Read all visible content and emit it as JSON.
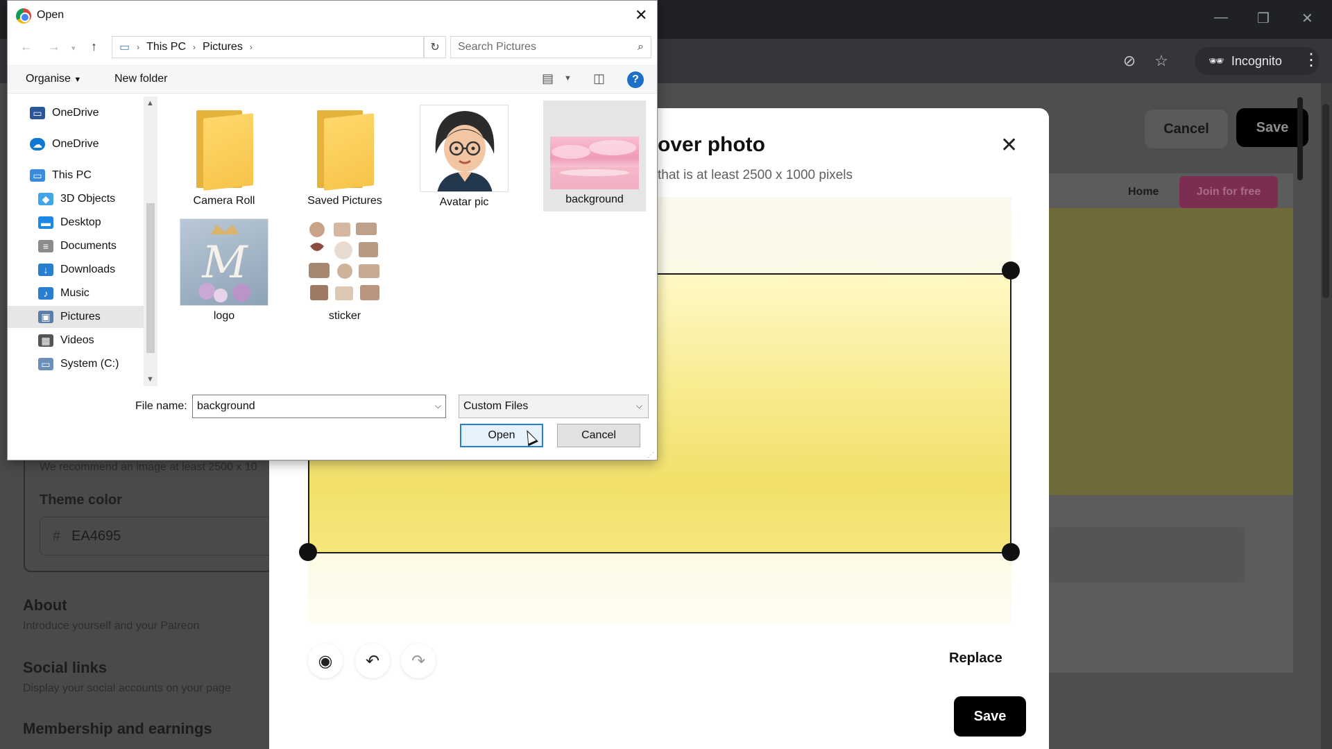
{
  "dialog": {
    "title": "Open",
    "breadcrumb": [
      "This PC",
      "Pictures"
    ],
    "search_placeholder": "Search Pictures",
    "commands": {
      "organise": "Organise",
      "new_folder": "New folder"
    },
    "nav": [
      {
        "label": "OneDrive",
        "icon": "onedrive-business-icon",
        "color": "#2b579a"
      },
      {
        "label": "OneDrive",
        "icon": "onedrive-cloud-icon",
        "color": "#0f78d4"
      },
      {
        "label": "This PC",
        "icon": "computer-icon",
        "color": "#3a8be0"
      },
      {
        "label": "3D Objects",
        "icon": "cube-icon",
        "color": "#42a5e8"
      },
      {
        "label": "Desktop",
        "icon": "desktop-icon",
        "color": "#1e88e5"
      },
      {
        "label": "Documents",
        "icon": "document-icon",
        "color": "#8c8c8c"
      },
      {
        "label": "Downloads",
        "icon": "download-icon",
        "color": "#2a7ed0"
      },
      {
        "label": "Music",
        "icon": "music-icon",
        "color": "#2a7ed0"
      },
      {
        "label": "Pictures",
        "icon": "pictures-icon",
        "color": "#5b7ea9"
      },
      {
        "label": "Videos",
        "icon": "film-icon",
        "color": "#555555"
      },
      {
        "label": "System (C:)",
        "icon": "drive-icon",
        "color": "#6b8fb8"
      }
    ],
    "files": [
      {
        "label": "Camera Roll",
        "kind": "folder"
      },
      {
        "label": "Saved Pictures",
        "kind": "folder"
      },
      {
        "label": "Avatar pic",
        "kind": "image"
      },
      {
        "label": "background",
        "kind": "image",
        "selected": true
      },
      {
        "label": "logo",
        "kind": "image"
      },
      {
        "label": "sticker",
        "kind": "image"
      }
    ],
    "file_name_label": "File name:",
    "file_name_value": "background",
    "file_type": "Custom Files",
    "open_label": "Open",
    "cancel_label": "Cancel"
  },
  "modal": {
    "title": "over photo",
    "subtitle": "that is at least 2500 x 1000 pixels",
    "replace_label": "Replace",
    "save_label": "Save",
    "crop_color": "#f2e06a"
  },
  "page": {
    "recommend": "We recommend an image at least 2500 x 10",
    "theme_label": "Theme color",
    "theme_hash": "#",
    "theme_value": "EA4695",
    "about_title": "About",
    "about_sub": "Introduce yourself and your Patreon",
    "social_title": "Social links",
    "social_sub": "Display your social accounts on your page",
    "membership_title": "Membership and earnings",
    "top_cancel": "Cancel",
    "top_save": "Save",
    "preview_home": "Home",
    "preview_join": "Join for free"
  },
  "browser": {
    "incognito_label": "Incognito"
  }
}
